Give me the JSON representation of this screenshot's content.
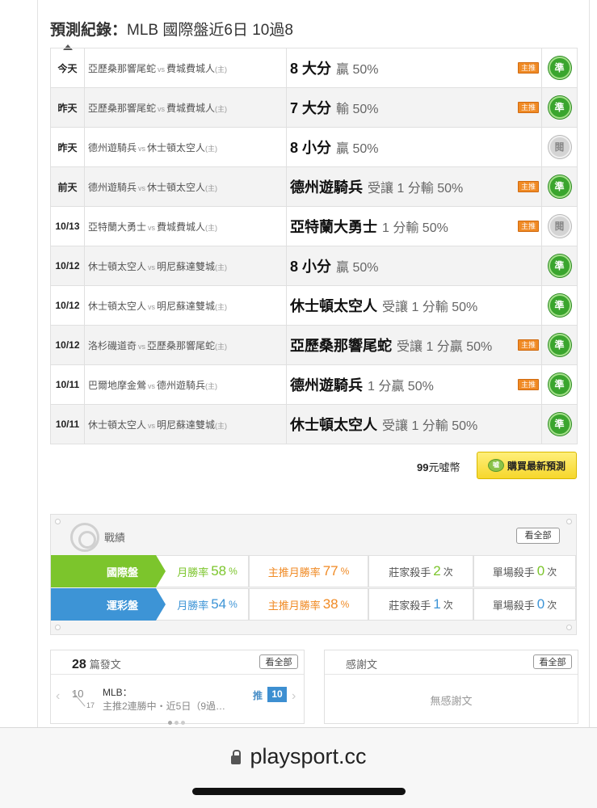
{
  "header": {
    "title_bold": "預測紀錄：",
    "title_rest": "MLB 國際盤近6日 10過8"
  },
  "records": [
    {
      "date": "今天",
      "away": "亞歷桑那響尾蛇",
      "vs": "vs",
      "home": "費城費城人",
      "home_mark": "(主)",
      "pick": "8 大分",
      "detail": "贏 50%",
      "tag": "主推",
      "result": "準"
    },
    {
      "date": "昨天",
      "away": "亞歷桑那響尾蛇",
      "vs": "vs",
      "home": "費城費城人",
      "home_mark": "(主)",
      "pick": "7 大分",
      "detail": "輸 50%",
      "tag": "主推",
      "result": "準"
    },
    {
      "date": "昨天",
      "away": "德州遊騎兵",
      "vs": "vs",
      "home": "休士頓太空人",
      "home_mark": "(主)",
      "pick": "8 小分",
      "detail": "贏 50%",
      "tag": "",
      "result": "閱"
    },
    {
      "date": "前天",
      "away": "德州遊騎兵",
      "vs": "vs",
      "home": "休士頓太空人",
      "home_mark": "(主)",
      "pick": "德州遊騎兵",
      "detail": "受讓 1 分輸 50%",
      "tag": "主推",
      "result": "準"
    },
    {
      "date": "10/13",
      "away": "亞特蘭大勇士",
      "vs": "vs",
      "home": "費城費城人",
      "home_mark": "(主)",
      "pick": "亞特蘭大勇士",
      "detail": "1 分輸 50%",
      "tag": "主推",
      "result": "閱"
    },
    {
      "date": "10/12",
      "away": "休士頓太空人",
      "vs": "vs",
      "home": "明尼蘇達雙城",
      "home_mark": "(主)",
      "pick": "8 小分",
      "detail": "贏 50%",
      "tag": "",
      "result": "準"
    },
    {
      "date": "10/12",
      "away": "休士頓太空人",
      "vs": "vs",
      "home": "明尼蘇達雙城",
      "home_mark": "(主)",
      "pick": "休士頓太空人",
      "detail": "受讓 1 分輸 50%",
      "tag": "",
      "result": "準"
    },
    {
      "date": "10/12",
      "away": "洛杉磯道奇",
      "vs": "vs",
      "home": "亞歷桑那響尾蛇",
      "home_mark": "(主)",
      "pick": "亞歷桑那響尾蛇",
      "detail": "受讓 1 分贏 50%",
      "tag": "主推",
      "result": "準"
    },
    {
      "date": "10/11",
      "away": "巴爾地摩金鶯",
      "vs": "vs",
      "home": "德州遊騎兵",
      "home_mark": "(主)",
      "pick": "德州遊騎兵",
      "detail": "1 分贏 50%",
      "tag": "主推",
      "result": "準"
    },
    {
      "date": "10/11",
      "away": "休士頓太空人",
      "vs": "vs",
      "home": "明尼蘇達雙城",
      "home_mark": "(主)",
      "pick": "休士頓太空人",
      "detail": "受讓 1 分輸 50%",
      "tag": "",
      "result": "準"
    }
  ],
  "purchase": {
    "price_num": "99",
    "price_unit": "元噓幣",
    "coin": "噓",
    "button_label": "購買最新預測"
  },
  "stats": {
    "label": "戰績",
    "see_all": "看全部",
    "rows": [
      {
        "name": "國際盤",
        "color": "#7cc52c",
        "value_color": "#7cc52c",
        "month_label": "月勝率",
        "month_val": "58",
        "main_label": "主推月勝率",
        "main_val": "77",
        "pct": "%",
        "house_label": "莊家殺手",
        "house_val": "2",
        "single_label": "單場殺手",
        "single_val": "0",
        "times": "次"
      },
      {
        "name": "運彩盤",
        "color": "#3d94d6",
        "value_color": "#3d94d6",
        "month_label": "月勝率",
        "month_val": "54",
        "main_label": "主推月勝率",
        "main_val": "38",
        "pct": "%",
        "house_label": "莊家殺手",
        "house_val": "1",
        "single_label": "單場殺手",
        "single_val": "0",
        "times": "次"
      }
    ]
  },
  "posts": {
    "count": "28",
    "label": "篇發文",
    "see_all": "看全部",
    "date_top": "10",
    "date_bottom": "17",
    "title": "MLB：",
    "snippet": "主推2連勝中・近5日（9過…",
    "push_label": "推",
    "push_count": "10"
  },
  "thanks": {
    "label": "感謝文",
    "see_all": "看全部",
    "empty": "無感謝文"
  },
  "browser": {
    "url": "playsport.cc"
  }
}
